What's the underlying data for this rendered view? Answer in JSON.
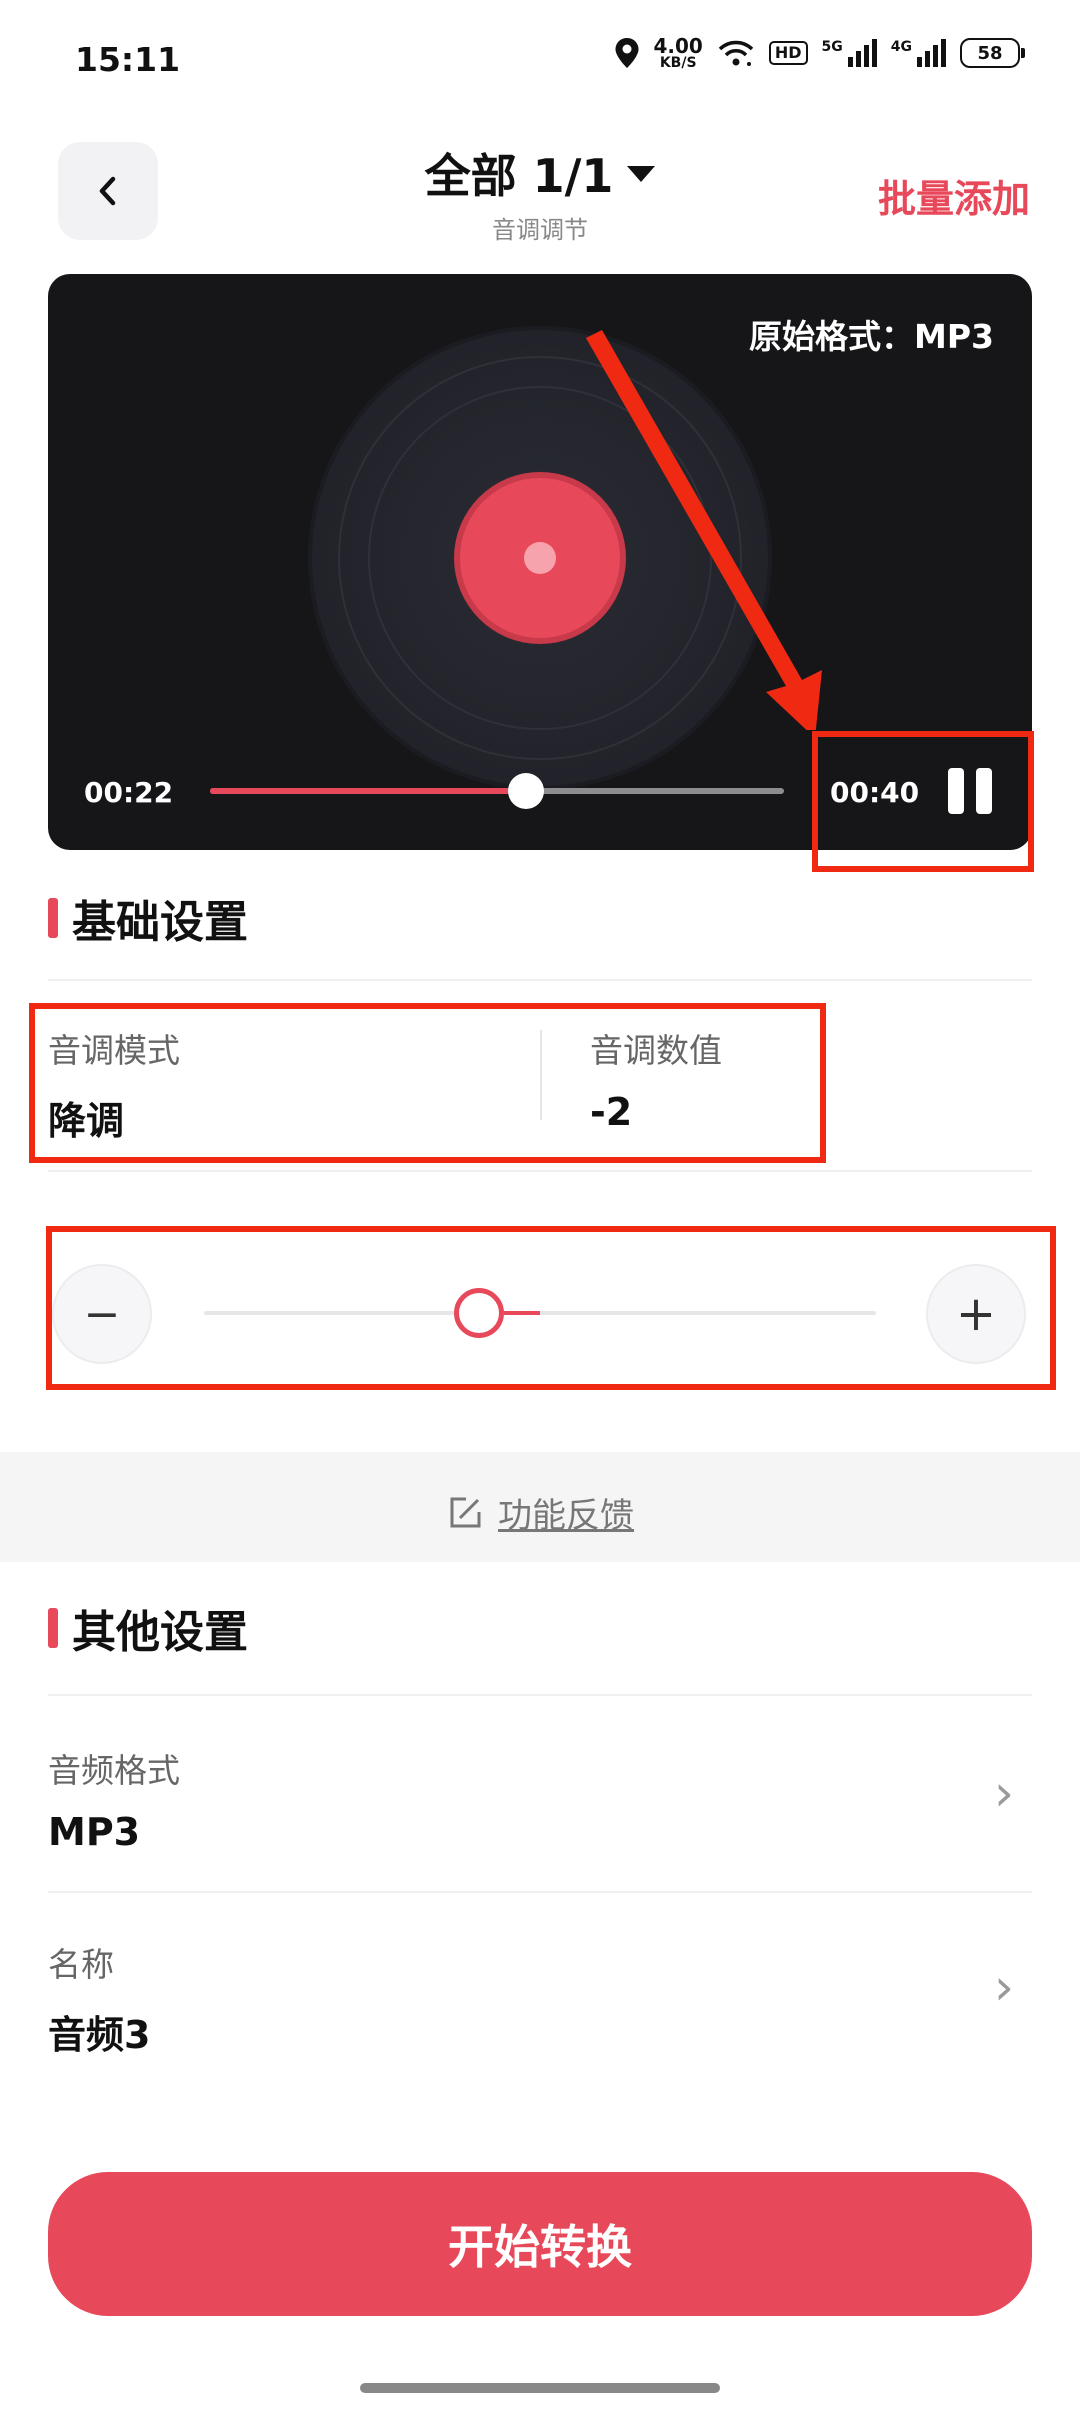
{
  "status_bar": {
    "time": "15:11",
    "net_speed": "4.00",
    "net_unit": "KB/S",
    "hd": "HD",
    "sig1": "5G",
    "sig2": "4G",
    "battery": "58"
  },
  "header": {
    "title": "全部 1/1",
    "subtitle": "音调调节",
    "batch_add": "批量添加"
  },
  "player": {
    "original_format": "原始格式：MP3",
    "current_time": "00:22",
    "duration": "00:40",
    "progress_fraction": 0.55
  },
  "basic_settings": {
    "title": "基础设置",
    "mode_label": "音调模式",
    "mode_value": "降调",
    "value_label": "音调数值",
    "value_value": "-2"
  },
  "pitch_slider": {
    "minus": "−",
    "plus": "+"
  },
  "feedback": {
    "label": "功能反馈"
  },
  "other_settings": {
    "title": "其他设置",
    "format_label": "音频格式",
    "format_value": "MP3",
    "name_label": "名称",
    "name_value": "音频3"
  },
  "start_button": "开始转换",
  "icons": [
    "back-icon",
    "location-icon",
    "wifi-icon",
    "pause-icon",
    "edit-icon",
    "chevron-right-icon"
  ],
  "colors": {
    "accent": "#e8495a",
    "highlight": "#f02a12"
  }
}
